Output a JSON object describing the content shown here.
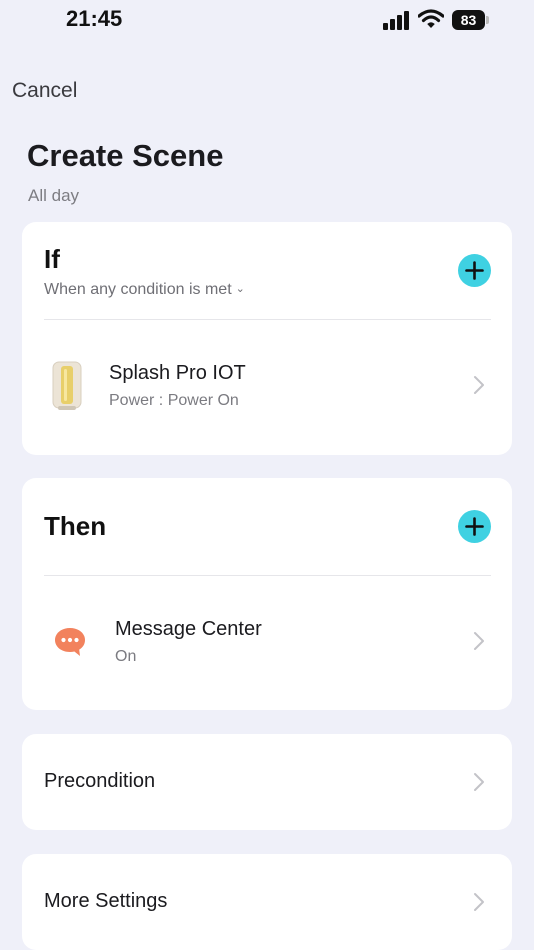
{
  "status_bar": {
    "time": "21:45",
    "battery_level": "83"
  },
  "header": {
    "cancel_label": "Cancel",
    "title": "Create Scene",
    "subtitle": "All day"
  },
  "if_section": {
    "heading": "If",
    "condition_mode": "When any condition is met",
    "items": [
      {
        "title": "Splash Pro IOT",
        "detail": "Power : Power On",
        "icon": "device-thumbnail"
      }
    ]
  },
  "then_section": {
    "heading": "Then",
    "items": [
      {
        "title": "Message Center",
        "detail": "On",
        "icon": "message-bubble-icon"
      }
    ]
  },
  "precondition": {
    "label": "Precondition"
  },
  "more_settings": {
    "label": "More Settings"
  },
  "colors": {
    "background": "#eff0f9",
    "card": "#ffffff",
    "accent_add": "#3fd1e2",
    "message_icon": "#f2825d"
  }
}
